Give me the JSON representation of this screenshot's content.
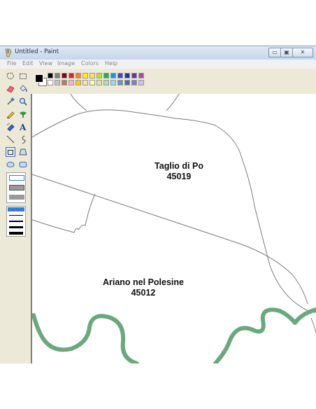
{
  "window": {
    "title": "Untitled - Paint",
    "buttons": {
      "minimize": "▭",
      "maximize": "▣",
      "close": "✕"
    }
  },
  "menu": [
    "File",
    "Edit",
    "View",
    "Image",
    "Colors",
    "Help"
  ],
  "toolbox": {
    "tools": [
      "free-form-select",
      "select",
      "eraser",
      "fill-with-color",
      "pick-color",
      "magnifier",
      "pencil",
      "brush",
      "airbrush",
      "text",
      "line",
      "curve",
      "rectangle",
      "polygon",
      "ellipse",
      "rounded-rectangle"
    ],
    "selected_tool": "rectangle"
  },
  "palette": {
    "foreground": "#000000",
    "background": "#ffffff",
    "colors": [
      "#000000",
      "#7f7f7f",
      "#880015",
      "#ed1c24",
      "#ff7f27",
      "#fff200",
      "#ffe05a",
      "#b5e61d",
      "#22b14c",
      "#00a2e8",
      "#3f48cc",
      "#2d2ea3",
      "#7030a0",
      "#a349a4",
      "#ffffff",
      "#c3c3c3",
      "#b97a57",
      "#ffaec9",
      "#ffc90e",
      "#efe4b0",
      "#fffab0",
      "#d9e8a0",
      "#a8e0b0",
      "#99d9ea",
      "#7092be",
      "#5a6aa0",
      "#8080c0",
      "#c8bfe7"
    ]
  },
  "map": {
    "labels": [
      {
        "name": "Taglio di Po",
        "code": "45019"
      },
      {
        "name": "Ariano nel Polesine",
        "code": "45012"
      }
    ],
    "colors": {
      "border": "#7a7a7a",
      "river": "#6aa87d"
    }
  }
}
